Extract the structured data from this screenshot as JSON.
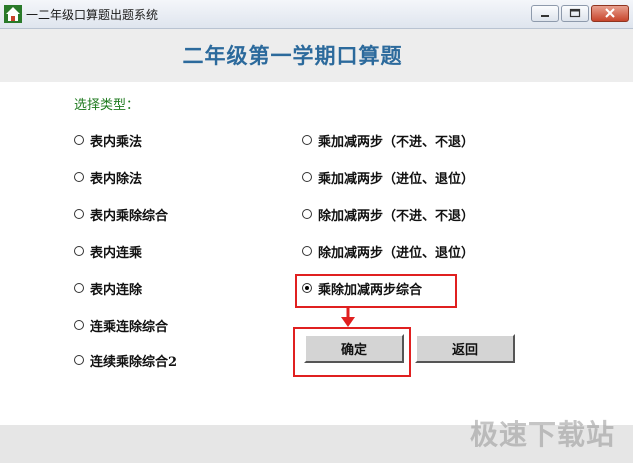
{
  "window": {
    "title": "一二年级口算题出题系统",
    "controls": [
      "minimize",
      "maximize",
      "close"
    ]
  },
  "header": {
    "title": "二年级第一学期口算题"
  },
  "section": {
    "label": "选择类型："
  },
  "options": [
    {
      "label": "表内乘法",
      "checked": false
    },
    {
      "label": "表内除法",
      "checked": false
    },
    {
      "label": "表内乘除综合",
      "checked": false
    },
    {
      "label": "表内连乘",
      "checked": false
    },
    {
      "label": "表内连除",
      "checked": false
    },
    {
      "label": "连乘连除综合",
      "checked": false
    },
    {
      "label": "连续乘除综合2",
      "checked": false
    },
    {
      "label": "乘加减两步（不进、不退）",
      "checked": false
    },
    {
      "label": "乘加减两步（进位、退位）",
      "checked": false
    },
    {
      "label": "除加减两步（不进、不退）",
      "checked": false
    },
    {
      "label": "除加减两步（进位、退位）",
      "checked": false
    },
    {
      "label": "乘除加减两步综合",
      "checked": true
    }
  ],
  "buttons": {
    "confirm": "确定",
    "back": "返回"
  },
  "annotations": {
    "highlight_color": "#e02020"
  },
  "watermark": "极速下载站",
  "icons": {
    "app": "house-icon",
    "minimize": "minimize-icon",
    "maximize": "maximize-icon",
    "close": "close-icon",
    "arrow": "arrow-down-icon"
  }
}
